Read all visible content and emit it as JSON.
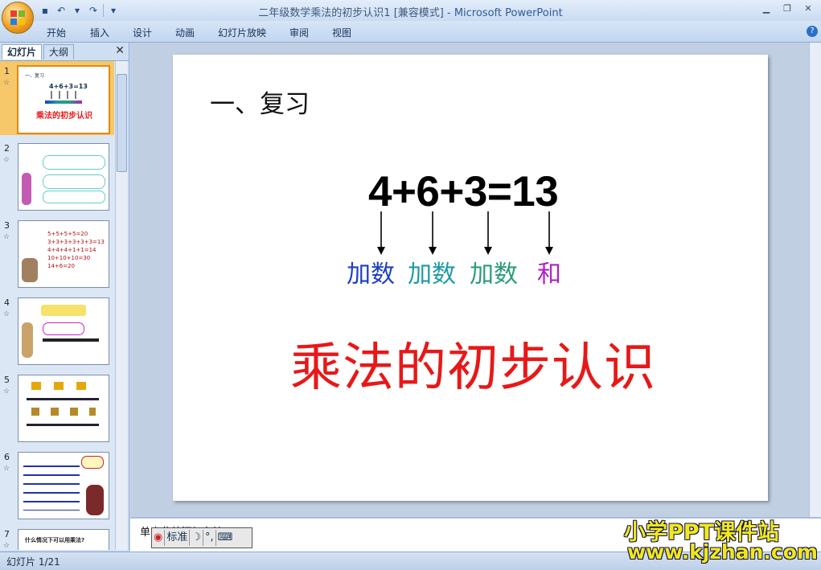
{
  "window": {
    "title": "二年级数学乘法的初步认识1 [兼容模式]",
    "app_name": "- Microsoft PowerPoint"
  },
  "ribbon": {
    "tabs": [
      "开始",
      "插入",
      "设计",
      "动画",
      "幻灯片放映",
      "审阅",
      "视图"
    ]
  },
  "pane": {
    "tab_slides": "幻灯片",
    "tab_outline": "大纲",
    "slide_numbers": [
      "1",
      "2",
      "3",
      "4",
      "5",
      "6",
      "7"
    ],
    "thumb1": {
      "heading": "一、复习",
      "eq": "4+6+3=13",
      "title": "乘法的初步认识"
    },
    "thumb3": {
      "lines": [
        "5+5+5+5=20",
        "3+3+3+3+3+3=13",
        "4+4+4+1+1=14",
        "10+10+10=30",
        "14+6=20"
      ]
    },
    "thumb7": {
      "text": "什么情况下可以用乘法?"
    }
  },
  "slide": {
    "heading": "一、复习",
    "equation": "4+6+3=13",
    "labels": [
      {
        "text": "加数",
        "color": "#1e3fbf"
      },
      {
        "text": "加数",
        "color": "#1f9aa6"
      },
      {
        "text": "加数",
        "color": "#2b9c7a"
      },
      {
        "text": "和",
        "color": "#b020c8"
      }
    ],
    "title": "乘法的初步认识",
    "title_color": "#e81818"
  },
  "notes": {
    "text": "单击此处添加备注"
  },
  "ime": {
    "mode": "标准"
  },
  "status": {
    "slide_counter": "幻灯片 1/21"
  },
  "watermark": {
    "line1": "小学PPT课件站",
    "line2": "www.kjzhan.com"
  }
}
